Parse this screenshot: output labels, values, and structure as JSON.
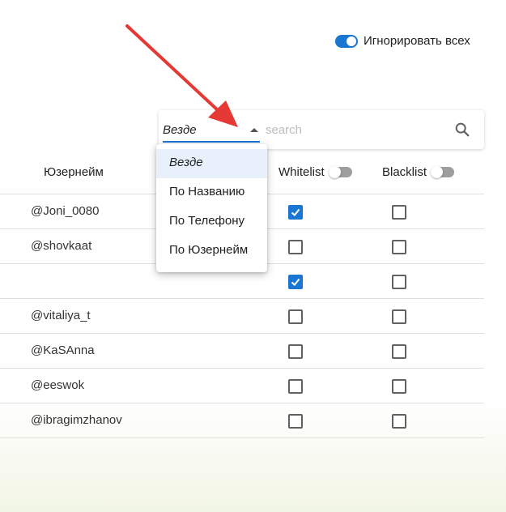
{
  "header": {
    "ignore_all_label": "Игнорировать всех",
    "ignore_all_on": true
  },
  "search": {
    "scope_value": "Везде",
    "placeholder": "search",
    "value": ""
  },
  "dropdown": {
    "options": [
      "Везде",
      "По Названию",
      "По Телефону",
      "По Юзернейм"
    ],
    "selected_index": 0
  },
  "table": {
    "columns": {
      "username": "Юзернейм",
      "whitelist": "Whitelist",
      "blacklist": "Blacklist"
    },
    "whitelist_toggle_on": false,
    "blacklist_toggle_on": false,
    "rows": [
      {
        "username": "@Joni_0080",
        "whitelist": true,
        "blacklist": false
      },
      {
        "username": "@shovkaat",
        "whitelist": false,
        "blacklist": false
      },
      {
        "username": "",
        "whitelist": true,
        "blacklist": false
      },
      {
        "username": "@vitaliya_t",
        "whitelist": false,
        "blacklist": false
      },
      {
        "username": "@KaSAnna",
        "whitelist": false,
        "blacklist": false
      },
      {
        "username": "@eeswok",
        "whitelist": false,
        "blacklist": false
      },
      {
        "username": "@ibragimzhanov",
        "whitelist": false,
        "blacklist": false
      }
    ]
  },
  "colors": {
    "accent": "#1976d2",
    "annotation_arrow": "#e53935"
  }
}
